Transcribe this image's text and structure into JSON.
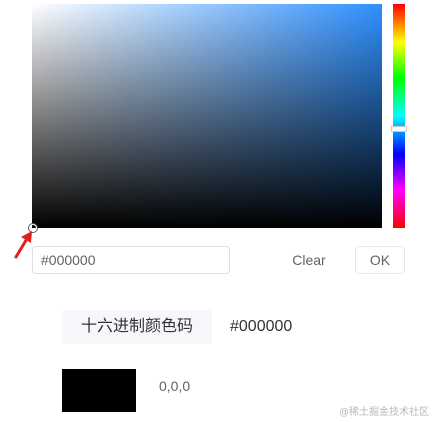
{
  "color_picker": {
    "hex_input_value": "#000000",
    "clear_label": "Clear",
    "ok_label": "OK",
    "hue_percent": 58
  },
  "result": {
    "hex_label": "十六进制颜色码",
    "hex_value": "#000000",
    "swatch_color": "#000000",
    "rgb_value": "0,0,0"
  },
  "watermark": "@稀土掘金技术社区",
  "icons": {
    "pointer": "red-arrow-icon"
  }
}
